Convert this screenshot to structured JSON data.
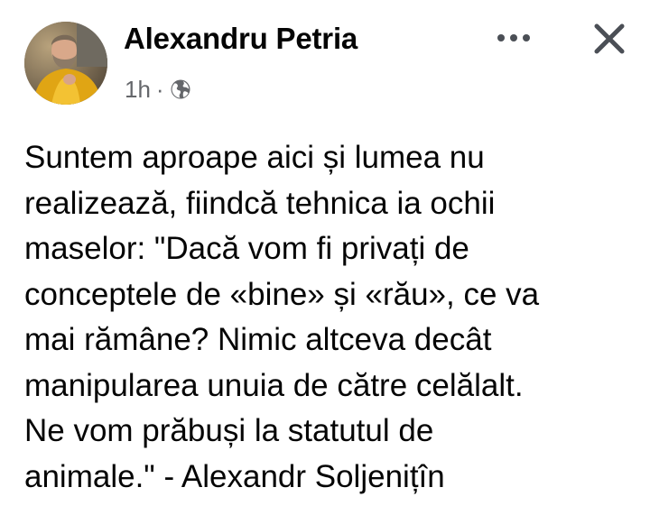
{
  "post": {
    "author": "Alexandru Petria",
    "time": "1h",
    "separator": "·",
    "audience_icon": "globe-icon",
    "text": "Suntem aproape aici și lumea nu\nrealizează, fiindcă tehnica ia ochii\nmaselor: \"Dacă vom fi privați de\nconceptele de «bine» și «rău», ce va\nmai rămâne? Nimic altceva decât\nmanipularea unuia de către celălalt.\nNe vom prăbuși la statutul de\nanimale.\" - Alexandr Soljenițîn"
  },
  "actions": {
    "more_icon": "more-horizontal-icon",
    "close_icon": "close-icon"
  },
  "colors": {
    "text": "#050505",
    "secondary": "#65676b",
    "icon": "#4b4f56"
  }
}
